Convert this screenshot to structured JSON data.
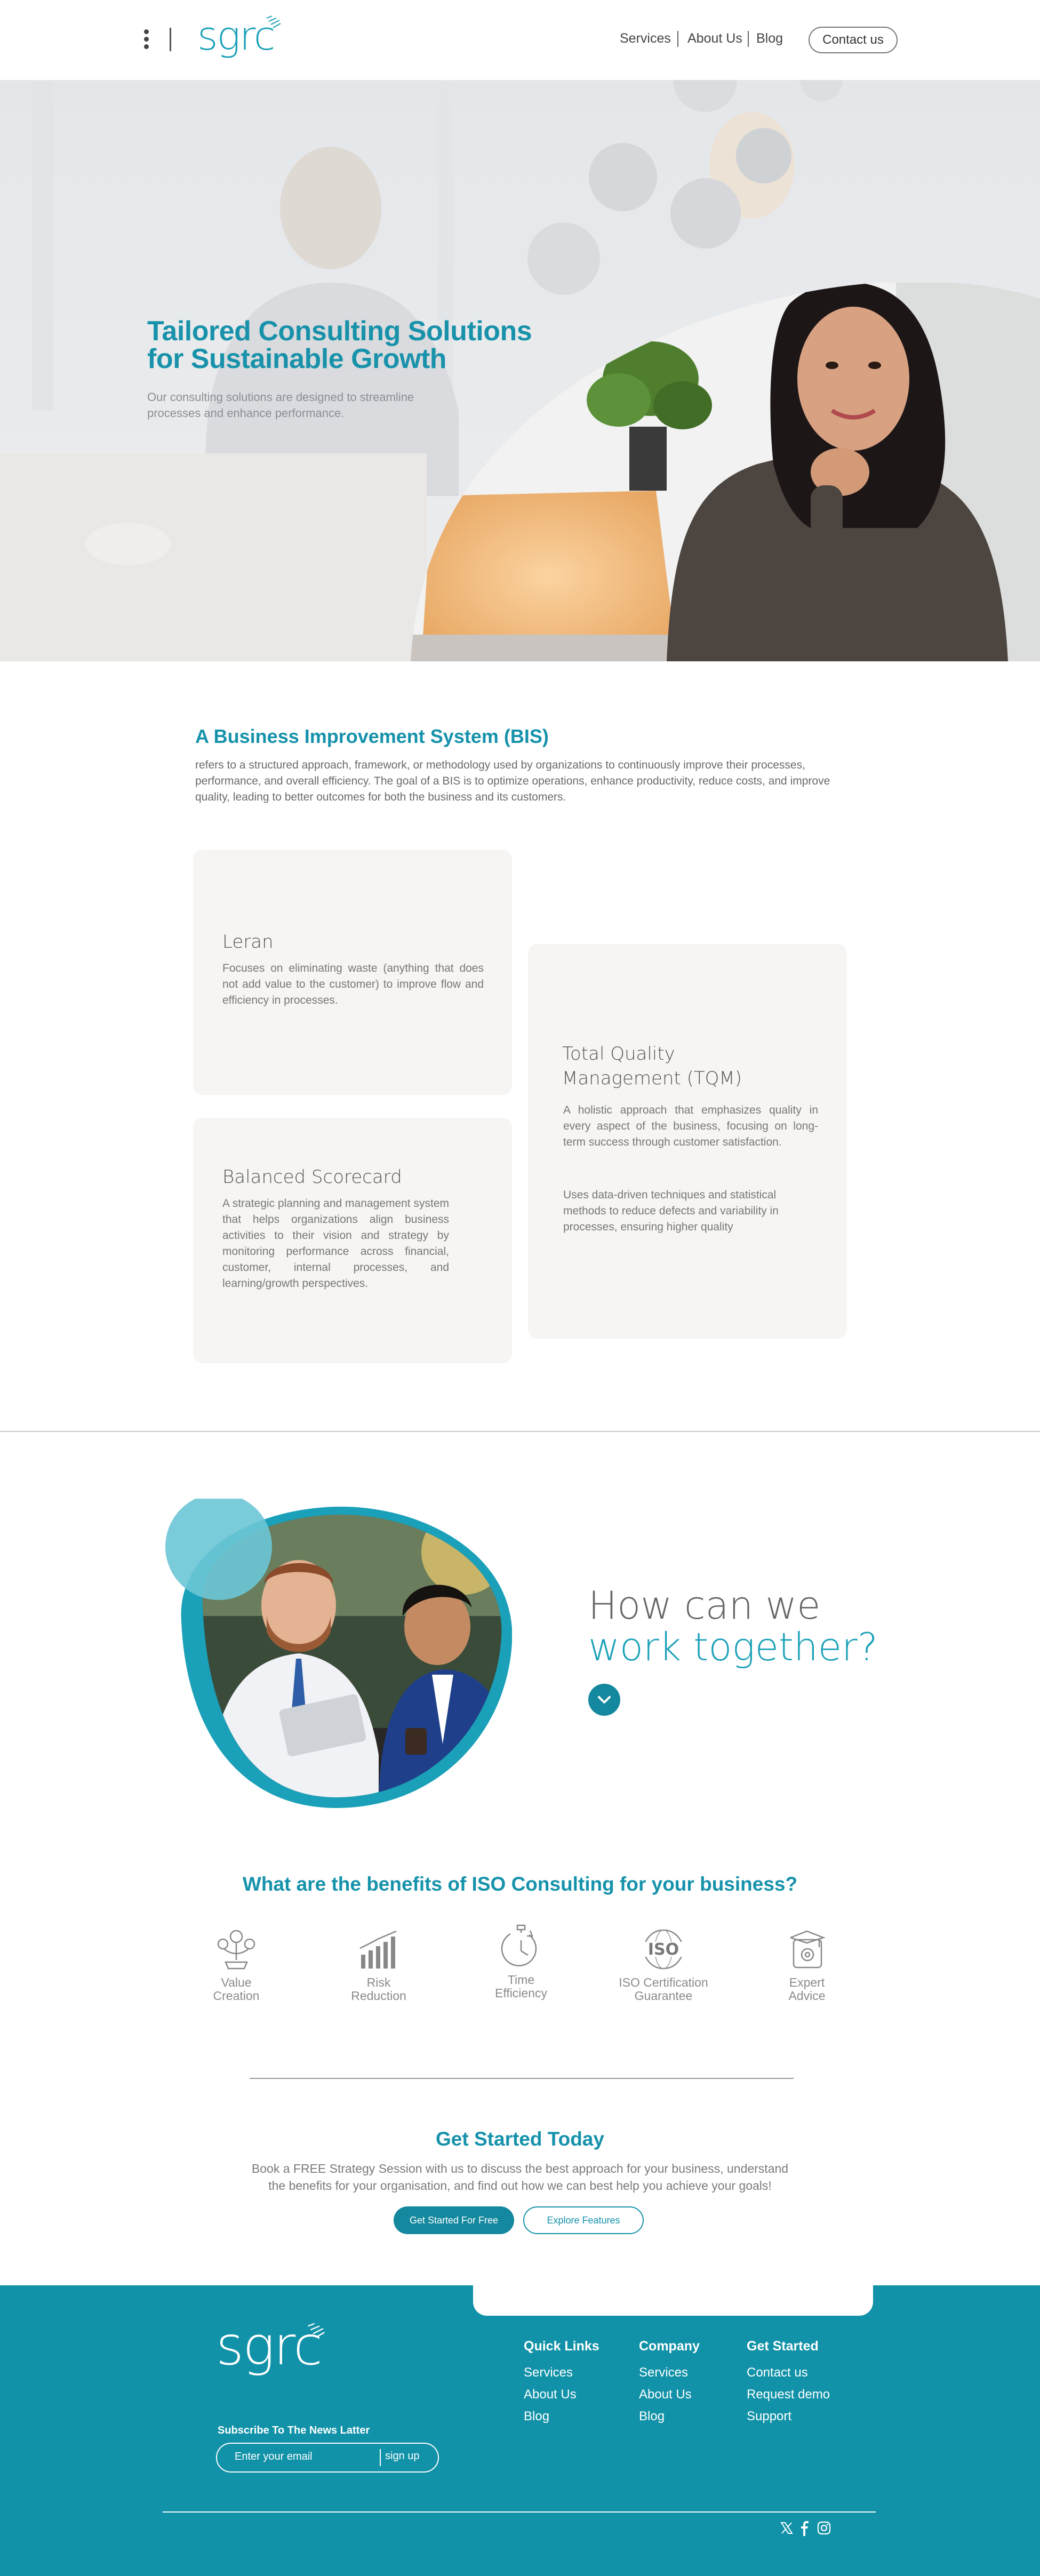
{
  "header": {
    "logo": "sgrc",
    "nav": [
      "Services",
      "About Us",
      "Blog"
    ],
    "contact_label": "Contact us"
  },
  "hero": {
    "title_line1": "Tailored Consulting Solutions",
    "title_line2": "for Sustainable Growth",
    "subtitle": "Our consulting solutions are designed to streamline processes and enhance performance."
  },
  "bis": {
    "title": "A Business Improvement System (BIS)",
    "body": "refers to a structured approach, framework, or methodology used by organizations to continuously improve their processes, performance, and overall efficiency. The goal of a BIS is to optimize operations, enhance productivity, reduce costs, and improve quality, leading to better outcomes for both the business and its customers.",
    "cards": [
      {
        "title": "Leran",
        "text": "Focuses on eliminating waste (anything that does not add value to the customer) to improve flow and efficiency in processes."
      },
      {
        "title": "Balanced Scorecard",
        "text": "A strategic planning and management system that helps organizations align business activities to their vision and strategy by monitoring performance across financial, customer, internal processes, and learning/growth perspectives."
      },
      {
        "title_line1": "Total Quality",
        "title_line2": "Management (TQM)",
        "text1": "A holistic approach that emphasizes quality in every aspect of the business, focusing on long-term success through customer satisfaction.",
        "text2": "Uses data-driven techniques and statistical methods to reduce defects and variability in processes, ensuring higher quality"
      }
    ]
  },
  "work": {
    "line1": "How can we",
    "line2": "work together?"
  },
  "benefits": {
    "title": "What are the benefits of ISO Consulting for your business?",
    "items": [
      {
        "line1": "Value",
        "line2": "Creation",
        "icon": "value-creation-icon"
      },
      {
        "line1": "Risk",
        "line2": "Reduction",
        "icon": "bar-chart-icon"
      },
      {
        "line1": "Time",
        "line2": "Efficiency",
        "icon": "stopwatch-icon"
      },
      {
        "line1": "ISO Certification",
        "line2": "Guarantee",
        "icon": "iso-globe-icon"
      },
      {
        "line1": "Expert",
        "line2": "Advice",
        "icon": "expert-advice-icon"
      }
    ]
  },
  "get_started": {
    "title": "Get Started Today",
    "body_line1": "Book a FREE Strategy Session with us to discuss the best approach for your business, understand",
    "body_line2": "the benefits for your organisation, and find out how we can best help you achieve your goals!",
    "btn_primary": "Get Started For Free",
    "btn_secondary": "Explore Features"
  },
  "footer": {
    "logo": "sgrc",
    "quick_links": {
      "title": "Quick Links",
      "items": [
        "Services",
        "About Us",
        "Blog"
      ]
    },
    "company": {
      "title": "Company",
      "items": [
        "Services",
        "About Us",
        "Blog"
      ]
    },
    "get_started": {
      "title": "Get Started",
      "items": [
        "Contact us",
        "Request demo",
        "Support"
      ]
    },
    "subscribe_title": "Subscribe To The News Latter",
    "subscribe_placeholder": "Enter your email",
    "subscribe_btn": "sign up"
  },
  "colors": {
    "brand": "#1592ab",
    "footer": "#1192a8",
    "card": "#f6f5f3"
  }
}
